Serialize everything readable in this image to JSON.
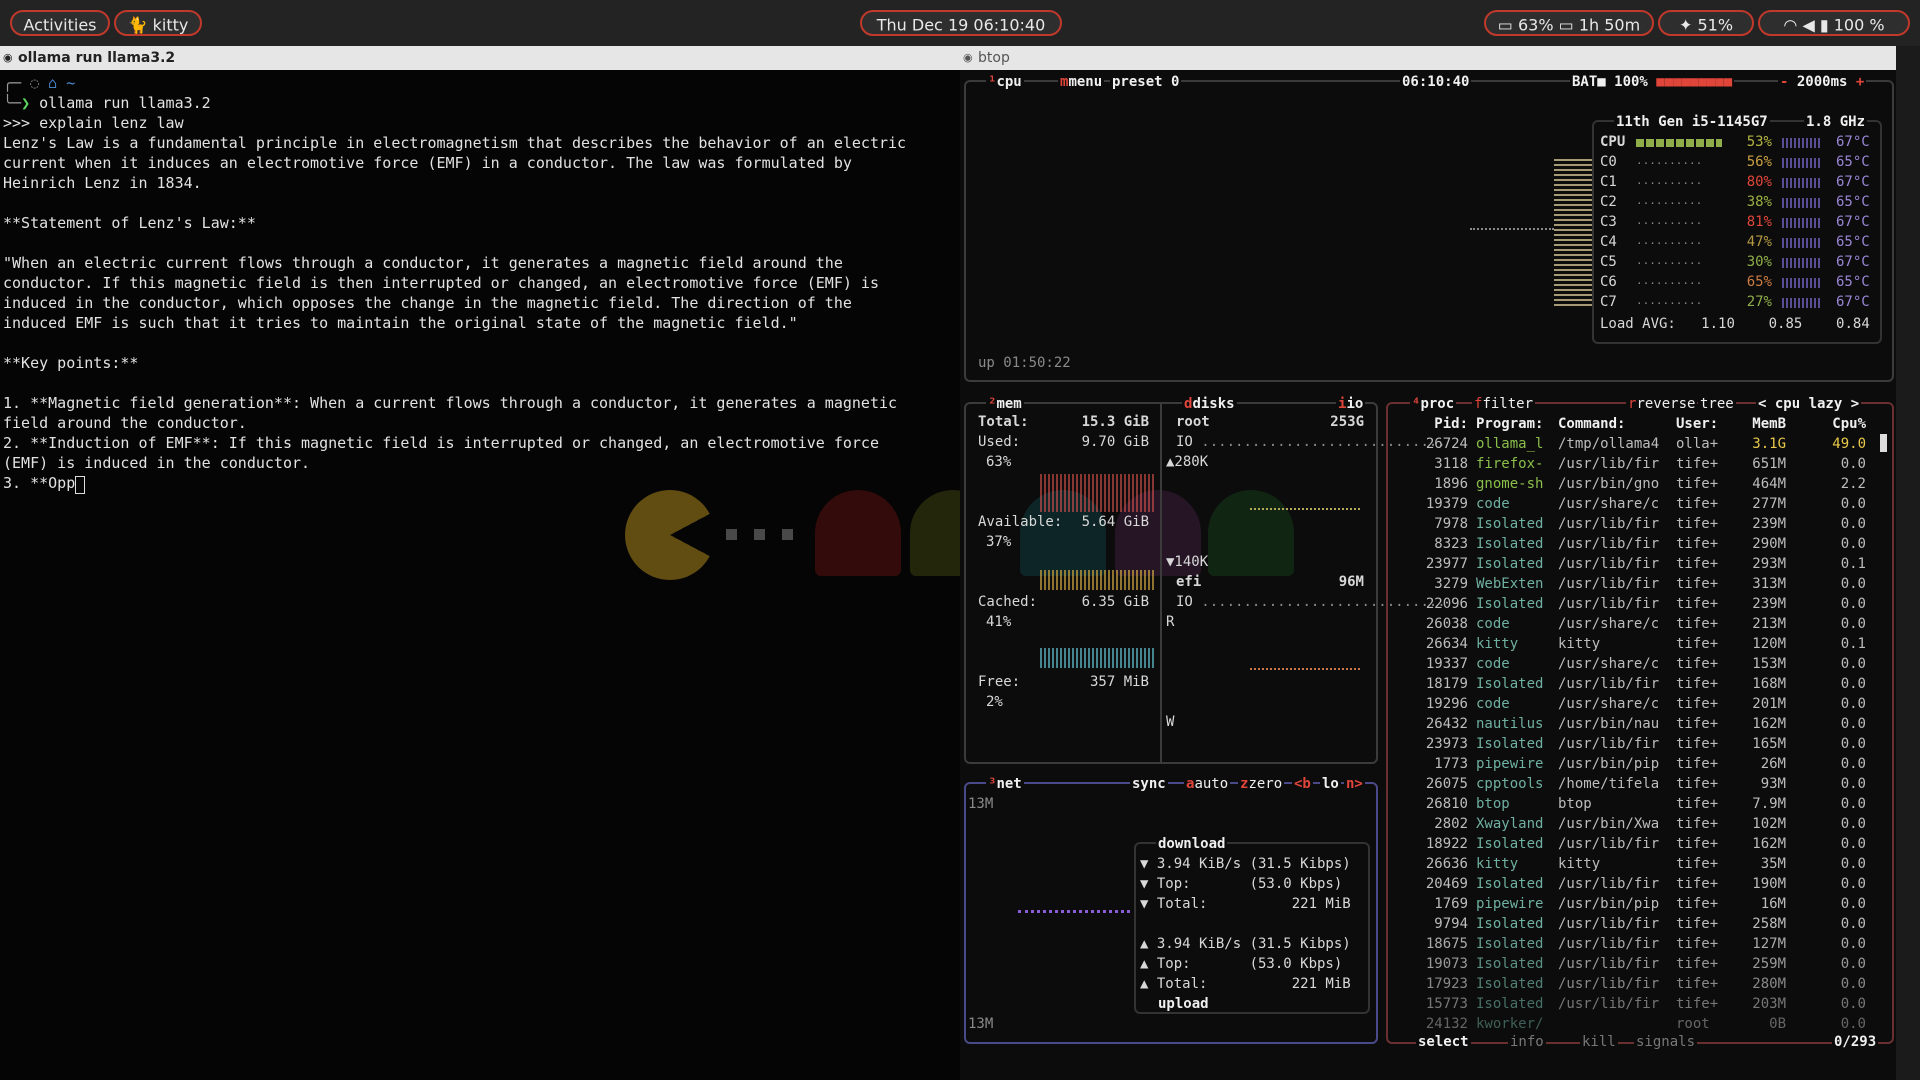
{
  "topbar": {
    "activities": "Activities",
    "kitty": "kitty",
    "clock": "Thu Dec 19  06:10:40",
    "cpu_pct": "63%",
    "battery_time": "1h 50m",
    "brightness": "51%",
    "volume_pct": "100 %"
  },
  "left_window": {
    "title": "ollama run llama3.2",
    "prompt_path": "~",
    "command": "ollama run llama3.2",
    "lines": [
      ">>> explain lenz law",
      "Lenz's Law is a fundamental principle in electromagnetism that describes the behavior of an electric",
      "current when it induces an electromotive force (EMF) in a conductor. The law was formulated by",
      "Heinrich Lenz in 1834.",
      "",
      "**Statement of Lenz's Law:**",
      "",
      "\"When an electric current flows through a conductor, it generates a magnetic field around the",
      "conductor. If this magnetic field is then interrupted or changed, an electromotive force (EMF) is",
      "induced in the conductor, which opposes the change in the magnetic field. The direction of the",
      "induced EMF is such that it tries to maintain the original state of the magnetic field.\"",
      "",
      "**Key points:**",
      "",
      "1. **Magnetic field generation**: When a current flows through a conductor, it generates a magnetic",
      "field around the conductor.",
      "2. **Induction of EMF**: If this magnetic field is interrupted or changed, an electromotive force",
      "(EMF) is induced in the conductor.",
      "3. **Opp"
    ]
  },
  "btop": {
    "title": "btop",
    "cpu_box": {
      "label": "cpu",
      "menu": "menu",
      "preset": "preset 0",
      "clock": "06:10:40",
      "bat": "BAT■ 100%",
      "interval": "2000ms",
      "model": "11th Gen i5-1145G7",
      "freq": "1.8 GHz",
      "uptime": "up 01:50:22",
      "load_label": "Load AVG:",
      "load": [
        "1.10",
        "0.85",
        "0.84"
      ],
      "rows": [
        {
          "name": "CPU",
          "pct": "53%",
          "temp": "67°C"
        },
        {
          "name": "C0",
          "pct": "56%",
          "temp": "65°C"
        },
        {
          "name": "C1",
          "pct": "80%",
          "temp": "67°C"
        },
        {
          "name": "C2",
          "pct": "38%",
          "temp": "65°C"
        },
        {
          "name": "C3",
          "pct": "81%",
          "temp": "67°C"
        },
        {
          "name": "C4",
          "pct": "47%",
          "temp": "65°C"
        },
        {
          "name": "C5",
          "pct": "30%",
          "temp": "67°C"
        },
        {
          "name": "C6",
          "pct": "65%",
          "temp": "65°C"
        },
        {
          "name": "C7",
          "pct": "27%",
          "temp": "67°C"
        }
      ]
    },
    "mem_box": {
      "label": "mem",
      "total_label": "Total:",
      "total": "15.3 GiB",
      "used_label": "Used:",
      "used": "9.70 GiB",
      "used_pct": "63%",
      "avail_label": "Available:",
      "avail": "5.64 GiB",
      "avail_pct": "37%",
      "cached_label": "Cached:",
      "cached": "6.35 GiB",
      "cached_pct": "41%",
      "free_label": "Free:",
      "free": "357 MiB",
      "free_pct": "2%"
    },
    "disks_box": {
      "label": "disks",
      "io_label": "io",
      "root": "root",
      "root_size": "253G",
      "io": "IO",
      "read1": "▲280K",
      "read2": "▼140K",
      "efi": "efi",
      "efi_size": "96M",
      "r": "R",
      "w": "W"
    },
    "net_box": {
      "label": "net",
      "sync": "sync",
      "auto": "auto",
      "zero": "zero",
      "b": "<b",
      "lo": "lo",
      "n": "n>",
      "scale_top": "13M",
      "scale_bottom": "13M",
      "download": "download",
      "dl_rate": "▼ 3.94 KiB/s (31.5 Kibps)",
      "dl_top": "▼ Top:       (53.0 Kbps)",
      "dl_total": "▼ Total:          221 MiB",
      "ul_rate": "▲ 3.94 KiB/s (31.5 Kibps)",
      "ul_top": "▲ Top:       (53.0 Kbps)",
      "ul_total": "▲ Total:          221 MiB",
      "upload": "upload"
    },
    "proc_box": {
      "label": "proc",
      "filter": "filter",
      "reverse": "reverse",
      "tree": "tree",
      "sort": "< cpu lazy >",
      "select": "select",
      "info": "info",
      "kill": "kill",
      "signals": "signals",
      "count": "0/293",
      "headers": [
        "Pid:",
        "Program:",
        "Command:",
        "User:",
        "MemB",
        "Cpu%"
      ],
      "rows": [
        [
          "26724",
          "ollama_l",
          "/tmp/ollama4",
          "olla+",
          "3.1G",
          "49.0"
        ],
        [
          "3118",
          "firefox-",
          "/usr/lib/fir",
          "tife+",
          "651M",
          "0.0"
        ],
        [
          "1896",
          "gnome-sh",
          "/usr/bin/gno",
          "tife+",
          "464M",
          "2.2"
        ],
        [
          "19379",
          "code",
          "/usr/share/c",
          "tife+",
          "277M",
          "0.0"
        ],
        [
          "7978",
          "Isolated",
          "/usr/lib/fir",
          "tife+",
          "239M",
          "0.0"
        ],
        [
          "8323",
          "Isolated",
          "/usr/lib/fir",
          "tife+",
          "290M",
          "0.0"
        ],
        [
          "23977",
          "Isolated",
          "/usr/lib/fir",
          "tife+",
          "293M",
          "0.1"
        ],
        [
          "3279",
          "WebExten",
          "/usr/lib/fir",
          "tife+",
          "313M",
          "0.0"
        ],
        [
          "22096",
          "Isolated",
          "/usr/lib/fir",
          "tife+",
          "239M",
          "0.0"
        ],
        [
          "26038",
          "code",
          "/usr/share/c",
          "tife+",
          "213M",
          "0.0"
        ],
        [
          "26634",
          "kitty",
          "kitty",
          "tife+",
          "120M",
          "0.1"
        ],
        [
          "19337",
          "code",
          "/usr/share/c",
          "tife+",
          "153M",
          "0.0"
        ],
        [
          "18179",
          "Isolated",
          "/usr/lib/fir",
          "tife+",
          "168M",
          "0.0"
        ],
        [
          "19296",
          "code",
          "/usr/share/c",
          "tife+",
          "201M",
          "0.0"
        ],
        [
          "26432",
          "nautilus",
          "/usr/bin/nau",
          "tife+",
          "162M",
          "0.0"
        ],
        [
          "23973",
          "Isolated",
          "/usr/lib/fir",
          "tife+",
          "165M",
          "0.0"
        ],
        [
          "1773",
          "pipewire",
          "/usr/bin/pip",
          "tife+",
          "26M",
          "0.0"
        ],
        [
          "26075",
          "cpptools",
          "/home/tifela",
          "tife+",
          "93M",
          "0.0"
        ],
        [
          "26810",
          "btop",
          "btop",
          "tife+",
          "7.9M",
          "0.0"
        ],
        [
          "2802",
          "Xwayland",
          "/usr/bin/Xwa",
          "tife+",
          "102M",
          "0.0"
        ],
        [
          "18922",
          "Isolated",
          "/usr/lib/fir",
          "tife+",
          "162M",
          "0.0"
        ],
        [
          "26636",
          "kitty",
          "kitty",
          "tife+",
          "35M",
          "0.0"
        ],
        [
          "20469",
          "Isolated",
          "/usr/lib/fir",
          "tife+",
          "190M",
          "0.0"
        ],
        [
          "1769",
          "pipewire",
          "/usr/bin/pip",
          "tife+",
          "16M",
          "0.0"
        ],
        [
          "9794",
          "Isolated",
          "/usr/lib/fir",
          "tife+",
          "258M",
          "0.0"
        ],
        [
          "18675",
          "Isolated",
          "/usr/lib/fir",
          "tife+",
          "127M",
          "0.0"
        ],
        [
          "19073",
          "Isolated",
          "/usr/lib/fir",
          "tife+",
          "259M",
          "0.0"
        ],
        [
          "17923",
          "Isolated",
          "/usr/lib/fir",
          "tife+",
          "280M",
          "0.0"
        ],
        [
          "15773",
          "Isolated",
          "/usr/lib/fir",
          "tife+",
          "203M",
          "0.0"
        ],
        [
          "24132",
          "kworker/",
          "",
          "root",
          "0B",
          "0.0"
        ]
      ]
    }
  },
  "colors": {
    "accent": "#c0392b",
    "prog_green": "#8bbf4a",
    "prog_cyan": "#5fb7c9",
    "temp_purple": "#9a86d6"
  }
}
